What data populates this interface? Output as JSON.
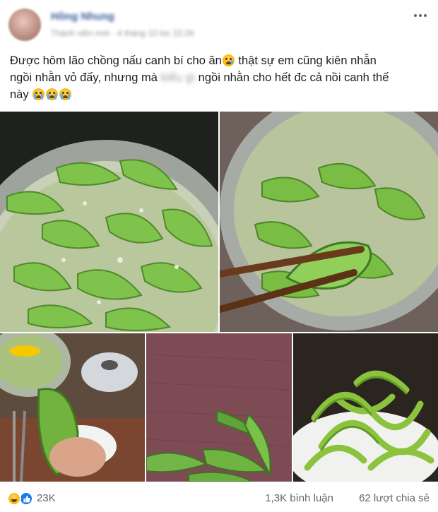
{
  "post": {
    "author": "Hồng Nhung",
    "meta": "Thành viên mới · 4 tháng 10 lúc 22:26",
    "text_line1": "Được hôm lão chồng nấu canh bí cho ăn",
    "text_line1_end": " thật sự em cũng kiên nhẫn",
    "text_line2_a": "ngồi nhằn vỏ đấy, nhưng mà ",
    "text_line2_blur": "kiểu gì",
    "text_line2_b": " ngồi nhằn cho hết đc cả nồi canh thế",
    "text_line3": "này",
    "emoji_sad": "sad-tear-emoji",
    "emoji_cry": "loudly-crying-emoji"
  },
  "photos": {
    "count": 5,
    "items": [
      "pot-of-squash-soup",
      "chopsticks-lifting-squash-slice",
      "peeled-squash-in-hand",
      "squash-peels-on-towel",
      "plate-of-squash-peels"
    ]
  },
  "footer": {
    "reactions": [
      "haha",
      "like"
    ],
    "reaction_count": "23K",
    "comments": "1,3K bình luận",
    "shares": "62 lượt chia sẻ"
  },
  "colors": {
    "link": "#385898",
    "meta": "#90949c",
    "text": "#1c1e21",
    "like_blue": "#1877f2",
    "squash_green": "#6cb640"
  }
}
